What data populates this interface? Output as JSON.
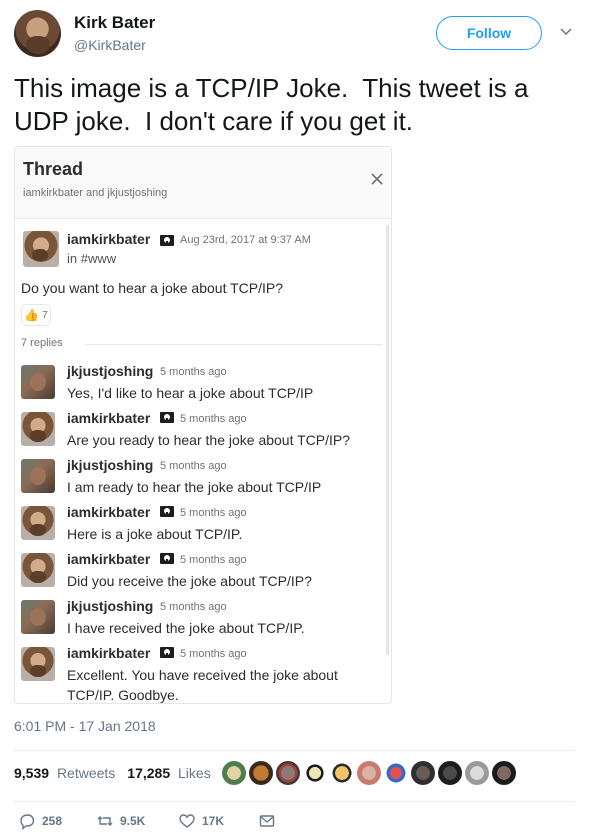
{
  "author": {
    "display_name": "Kirk Bater",
    "handle": "@KirkBater",
    "follow_label": "Follow"
  },
  "tweet": {
    "text": "This image is a TCP/IP Joke.  This tweet is a UDP joke.  I don't care if you get it."
  },
  "thread": {
    "title": "Thread",
    "participants": "iamkirkbater and jkjustjoshing",
    "first_message": {
      "user": "iamkirkbater",
      "date": "Aug 23rd, 2017 at 9:37 AM",
      "channel": "in #www",
      "text": "Do you want to hear a joke about TCP/IP?",
      "reaction_count": "7"
    },
    "replies_label": "7 replies",
    "replies": [
      {
        "user": "jkjustjoshing",
        "time": "5 months ago",
        "text": "Yes, I'd like to hear a joke about TCP/IP"
      },
      {
        "user": "iamkirkbater",
        "time": "5 months ago",
        "text": "Are you ready to hear the joke about TCP/IP?"
      },
      {
        "user": "jkjustjoshing",
        "time": "5 months ago",
        "text": "I am ready to hear the joke about TCP/IP"
      },
      {
        "user": "iamkirkbater",
        "time": "5 months ago",
        "text": "Here is a joke about TCP/IP."
      },
      {
        "user": "iamkirkbater",
        "time": "5 months ago",
        "text": "Did you receive the joke about TCP/IP?"
      },
      {
        "user": "jkjustjoshing",
        "time": "5 months ago",
        "text": "I have received the joke about TCP/IP."
      },
      {
        "user": "iamkirkbater",
        "time": "5 months ago",
        "text": "Excellent.  You have received the joke about TCP/IP.  Goodbye."
      }
    ]
  },
  "meta": {
    "timestamp": "6:01 PM - 17 Jan 2018",
    "retweets_count": "9,539",
    "retweets_label": "Retweets",
    "likes_count": "17,285",
    "likes_label": "Likes"
  },
  "actions": {
    "replies": "258",
    "retweets": "9.5K",
    "likes": "17K"
  },
  "colors": {
    "accent": "#1da1f2",
    "muted": "#657786"
  }
}
